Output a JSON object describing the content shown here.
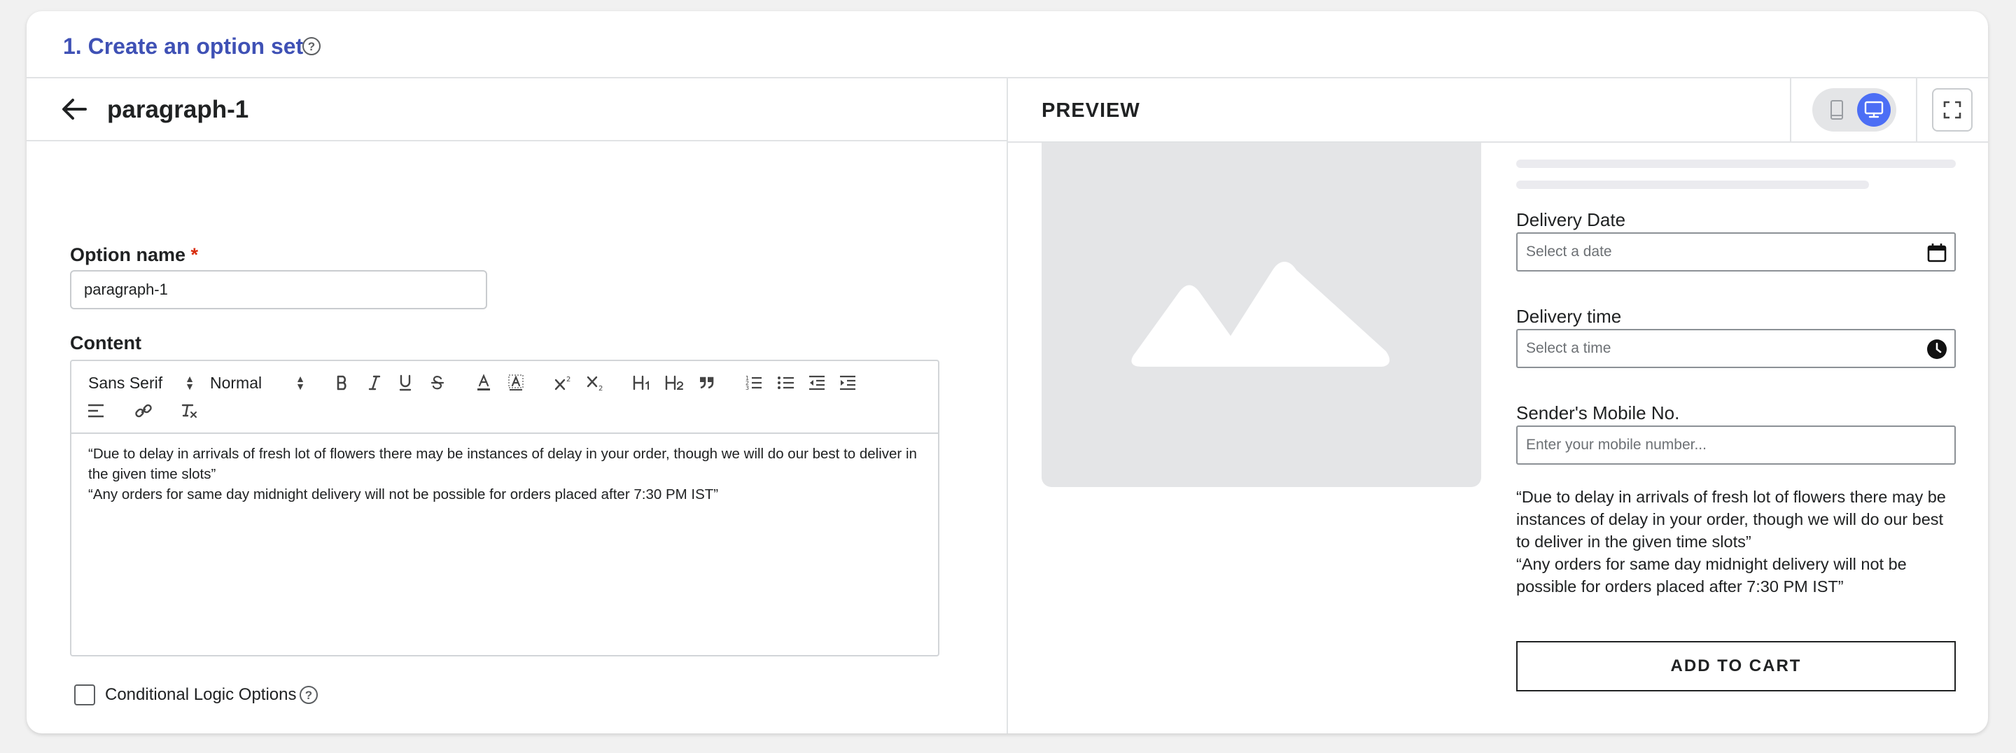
{
  "header": {
    "title": "1. Create an option set",
    "help_glyph": "?"
  },
  "editor_panel": {
    "back_icon": "arrow-left-icon",
    "option_title": "paragraph-1",
    "option_name_label": "Option name",
    "required_mark": "*",
    "option_name_value": "paragraph-1",
    "content_label": "Content",
    "toolbar": {
      "font_family": "Sans Serif",
      "font_size": "Normal",
      "icons": [
        "bold-icon",
        "italic-icon",
        "underline-icon",
        "strikethrough-icon",
        "text-color-icon",
        "background-color-icon",
        "superscript-icon",
        "subscript-icon",
        "heading-1-icon",
        "heading-2-icon",
        "blockquote-icon",
        "ordered-list-icon",
        "bullet-list-icon",
        "outdent-icon",
        "indent-icon",
        "align-icon",
        "link-icon",
        "clear-format-icon"
      ]
    },
    "content_lines": [
      "“Due to delay in arrivals of fresh lot of flowers there may be instances of delay in your order, though we will do our best to deliver in the given time slots”",
      "“Any orders for same day midnight delivery will not be possible for orders placed after 7:30 PM IST”"
    ],
    "conditional_logic_label": "Conditional Logic Options",
    "conditional_logic_checked": false
  },
  "preview": {
    "title": "PREVIEW",
    "device_modes": [
      "mobile-icon",
      "desktop-icon"
    ],
    "active_device": "desktop",
    "expand_icon": "expand-icon",
    "image_placeholder_icon": "mountain-image-icon",
    "fields": [
      {
        "label": "Delivery Date",
        "placeholder": "Select a date",
        "icon": "calendar-icon"
      },
      {
        "label": "Delivery time",
        "placeholder": "Select a time",
        "icon": "clock-icon"
      },
      {
        "label": "Sender's Mobile No.",
        "placeholder": "Enter your mobile number...",
        "icon": ""
      }
    ],
    "paragraph_lines": [
      "“Due to delay in arrivals of fresh lot of flowers there may be instances of delay in your order, though we will do our best to deliver in the given time slots”",
      "“Any orders for same day midnight delivery will not be possible for orders placed after 7:30 PM IST”"
    ],
    "add_to_cart_label": "ADD TO CART"
  },
  "colors": {
    "accent": "#3f51b5",
    "toggle_active": "#4c6ef5",
    "required": "#d82c0d",
    "placeholder_bg": "#e4e5e7"
  }
}
